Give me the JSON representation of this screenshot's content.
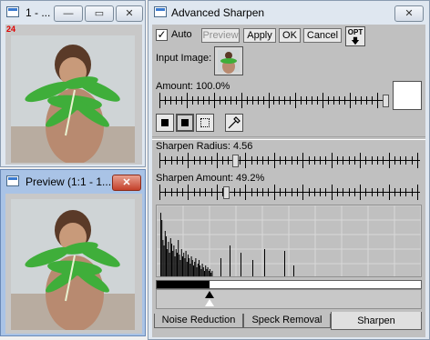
{
  "window_small": {
    "title": "1 - ...",
    "badge": "24",
    "minimize_label": "—",
    "restore_label": "▭",
    "close_label": "✕"
  },
  "window_preview": {
    "title": "Preview (1:1 - 1...",
    "close_label": "✕"
  },
  "window_main": {
    "title": "Advanced Sharpen",
    "close_label": "✕"
  },
  "controls": {
    "auto_checked": true,
    "auto_label": "Auto",
    "preview_label": "Preview",
    "apply_label": "Apply",
    "ok_label": "OK",
    "cancel_label": "Cancel",
    "opt_label": "OPT",
    "opt_arrow": "🡇"
  },
  "input_image_label": "Input Image:",
  "amount": {
    "label": "Amount: 100.0%",
    "value_percent": 100.0
  },
  "sharpen_radius": {
    "label": "Sharpen Radius: 4.56",
    "value": 4.56
  },
  "sharpen_amount": {
    "label": "Sharpen Amount: 49.2%",
    "value_percent": 49.2
  },
  "tabs": [
    {
      "label": "Noise Reduction",
      "active": false
    },
    {
      "label": "Speck Removal",
      "active": false
    },
    {
      "label": "Sharpen",
      "active": true
    }
  ],
  "colors": {
    "window_bg": "#c0c0c0",
    "preview_frame": "#a9c3e6",
    "close_red": "#c4402a",
    "histogram": "#000000"
  }
}
